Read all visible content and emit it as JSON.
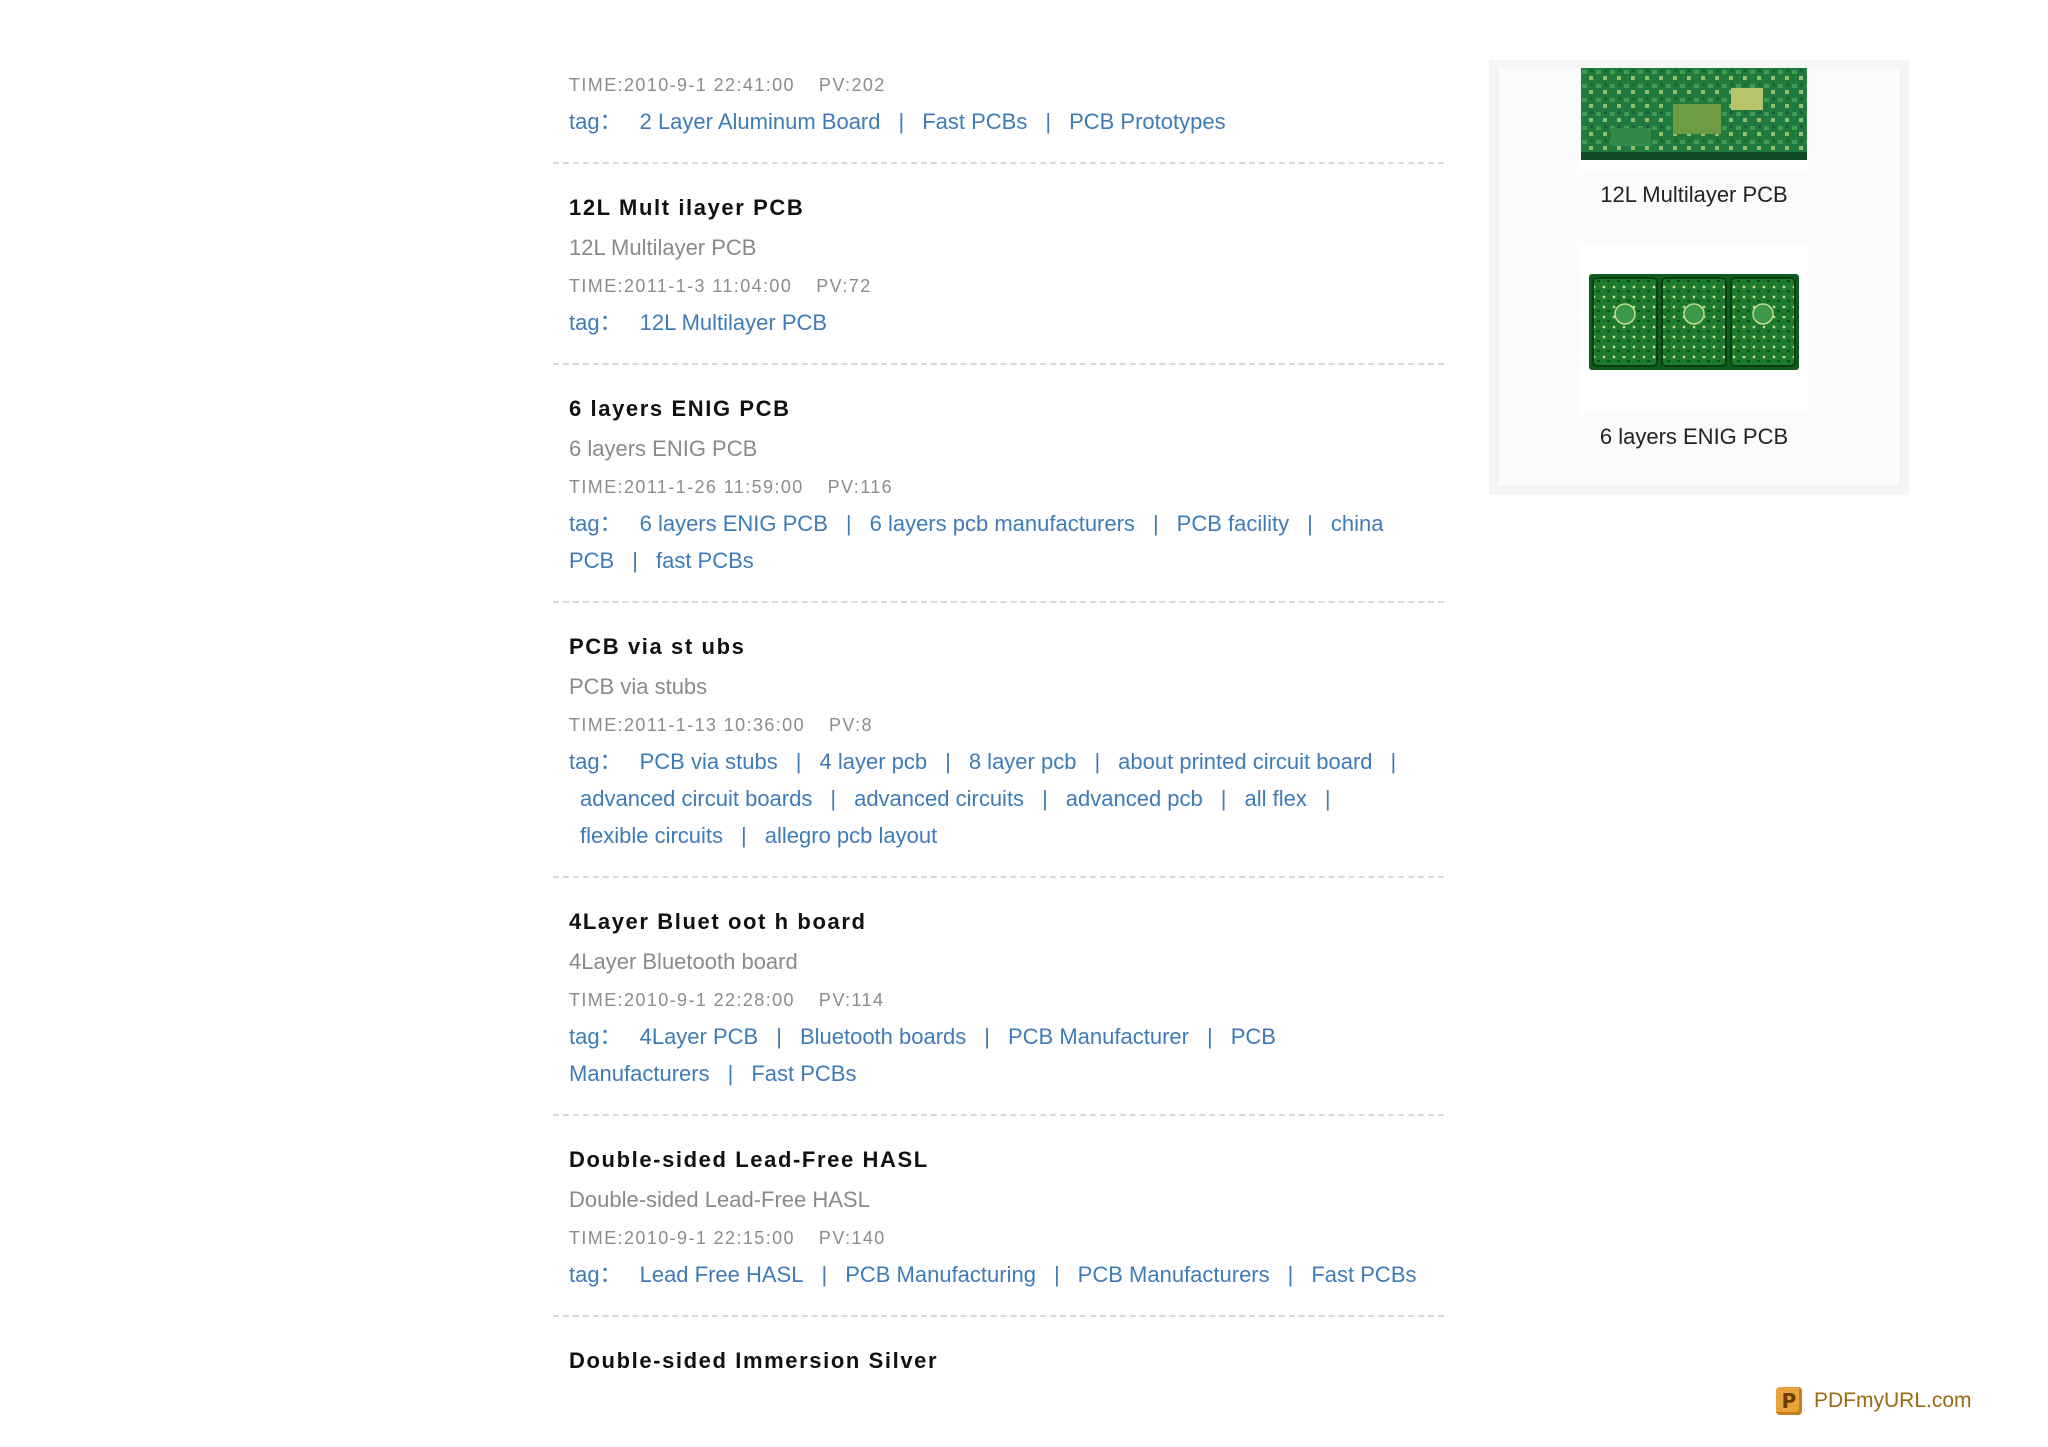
{
  "list": {
    "first_item": {
      "time": "TIME:2010-9-1 22:41:00",
      "pv": "PV:202",
      "tag_label": "tag：",
      "tags": [
        "2 Layer Aluminum Board",
        "Fast PCBs",
        "PCB Prototypes"
      ]
    },
    "items": [
      {
        "title": "12L Mult ilayer PCB",
        "subtitle": "12L Multilayer PCB",
        "time": "TIME:2011-1-3 11:04:00",
        "pv": "PV:72",
        "tag_label": "tag：",
        "tags": [
          "12L Multilayer PCB"
        ]
      },
      {
        "title": "6 layers ENIG PCB",
        "subtitle": "6 layers ENIG PCB",
        "time": "TIME:2011-1-26 11:59:00",
        "pv": "PV:116",
        "tag_label": "tag：",
        "tags": [
          "6 layers ENIG PCB",
          "6 layers pcb manufacturers",
          "PCB facility",
          "china PCB",
          "fast PCBs"
        ]
      },
      {
        "title": "PCB via st ubs",
        "subtitle": "PCB via stubs",
        "time": "TIME:2011-1-13 10:36:00",
        "pv": "PV:8",
        "tag_label": "tag：",
        "tags": [
          "PCB via stubs",
          "4 layer pcb",
          "8 layer pcb",
          "about printed circuit board",
          "advanced circuit boards",
          "advanced circuits",
          "advanced pcb",
          "all flex",
          "flexible circuits",
          "allegro pcb layout"
        ]
      },
      {
        "title": "4Layer Bluet oot h board",
        "subtitle": "4Layer Bluetooth board",
        "time": "TIME:2010-9-1 22:28:00",
        "pv": "PV:114",
        "tag_label": "tag：",
        "tags": [
          "4Layer PCB",
          "Bluetooth boards",
          "PCB Manufacturer",
          "PCB Manufacturers",
          "Fast PCBs"
        ]
      },
      {
        "title": "Double-sided Lead-Free HASL",
        "subtitle": "Double-sided Lead-Free HASL",
        "time": "TIME:2010-9-1 22:15:00",
        "pv": "PV:140",
        "tag_label": "tag：",
        "tags": [
          "Lead Free HASL",
          "PCB Manufacturing",
          "PCB Manufacturers",
          "Fast PCBs"
        ]
      }
    ],
    "last_title": "Double-sided Immersion Silver"
  },
  "sidebar": {
    "captions": [
      "12L Multilayer PCB",
      "6 layers ENIG PCB"
    ]
  },
  "footer": {
    "brand": "PDFmyURL.com"
  },
  "colors": {
    "link": "#3f7bb6",
    "pcb_green": "#1d6e2a",
    "brand": "#e8a33b"
  }
}
